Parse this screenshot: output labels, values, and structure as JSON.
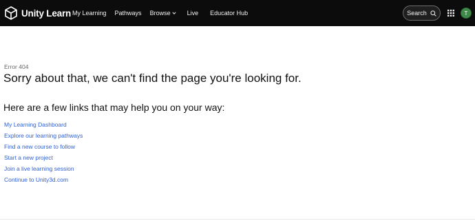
{
  "header": {
    "logo_text": "Unity Learn",
    "nav": [
      {
        "label": "My Learning",
        "has_dropdown": false
      },
      {
        "label": "Pathways",
        "has_dropdown": false
      },
      {
        "label": "Browse",
        "has_dropdown": true
      },
      {
        "label": "Live",
        "has_dropdown": false
      },
      {
        "label": "Educator Hub",
        "has_dropdown": false
      }
    ],
    "search_label": "Search",
    "avatar_initial": "T"
  },
  "main": {
    "error_code": "Error 404",
    "headline": "Sorry about that, we can't find the page you're looking for.",
    "subheadline": "Here are a few links that may help you on your way:",
    "links": [
      "My Learning Dashboard",
      "Explore our learning pathways",
      "Find a new course to follow",
      "Start a new project",
      "Join a live learning session",
      "Continue to Unity3d.com"
    ]
  },
  "colors": {
    "header_bg": "#0c0c0c",
    "link": "#2f5fd3",
    "avatar_bg": "#3f8a49"
  }
}
